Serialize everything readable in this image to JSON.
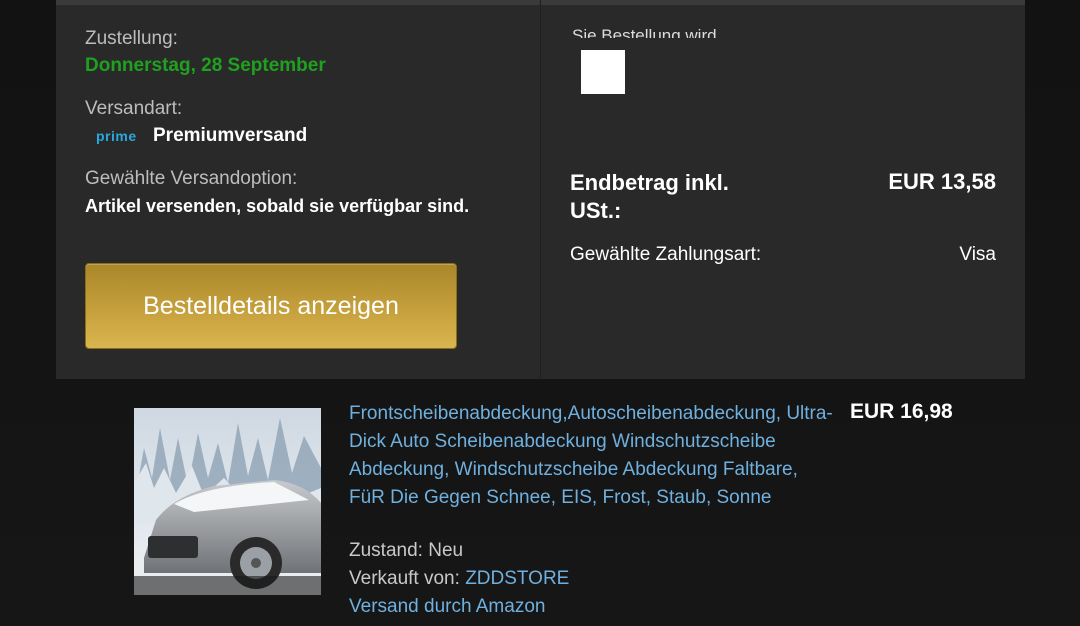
{
  "delivery": {
    "label": "Zustellung:",
    "date": "Donnerstag, 28 September"
  },
  "shipping": {
    "label": "Versandart:",
    "badge": "prime",
    "method": "Premiumversand"
  },
  "option": {
    "label": "Gewählte Versandoption:",
    "value": "Artikel versenden, sobald sie verfügbar sind."
  },
  "actions": {
    "details_button": "Bestelldetails anzeigen"
  },
  "summary": {
    "clipped_heading": "Sie Bestellung wird",
    "total_label": "Endbetrag inkl. USt.:",
    "total_value": "EUR 13,58",
    "payment_label": "Gewählte Zahlungsart:",
    "payment_value": "Visa"
  },
  "product": {
    "title": "Frontscheibenabdeckung,Autoscheibenabdeckung, Ultra-Dick Auto Scheibenabdeckung Windschutzscheibe Abdeckung, Windschutzscheibe Abdeckung Faltbare, FüR Die Gegen Schnee, EIS, Frost, Staub, Sonne",
    "price": "EUR 16,98",
    "condition_label": "Zustand:",
    "condition_value": "Neu",
    "seller_label": "Verkauft von:",
    "seller_value": "ZDDSTORE",
    "fulfilment": "Versand durch Amazon"
  },
  "colors": {
    "accent_green": "#1fa11f",
    "link_blue": "#6fb0de",
    "button_gold": "#c6a03c",
    "prime_blue": "#2aa8de"
  }
}
